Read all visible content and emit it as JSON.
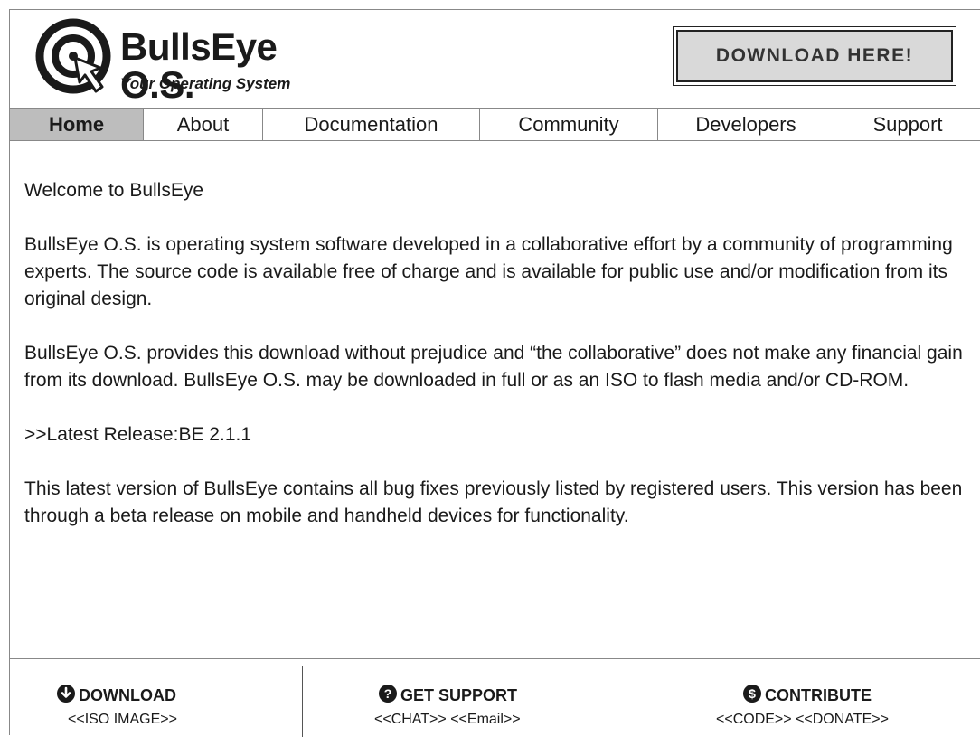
{
  "header": {
    "brand_name": "BullsEye O.S.",
    "tagline": "Your Operating System",
    "download_label": "DOWNLOAD HERE!"
  },
  "nav": {
    "items": [
      {
        "label": "Home",
        "active": true
      },
      {
        "label": "About"
      },
      {
        "label": "Documentation"
      },
      {
        "label": "Community"
      },
      {
        "label": "Developers"
      },
      {
        "label": "Support"
      }
    ]
  },
  "main": {
    "welcome": "Welcome to BullsEye",
    "para1": "BullsEye O.S. is operating system software developed in a collaborative effort by a community of programming experts. The source code is available free of charge and is available for public use and/or modification from its original design.",
    "para2": "BullsEye O.S. provides this download without prejudice and “the collaborative” does not make any financial gain from its download. BullsEye O.S. may be downloaded in full or as an ISO to flash media and/or CD-ROM.",
    "latest_release": ">>Latest Release:BE 2.1.1",
    "para3": "This latest version of BullsEye contains all bug fixes previously listed by registered users. This version has been through a beta release on mobile and handheld devices for functionality."
  },
  "footer": {
    "download": {
      "title": "DOWNLOAD",
      "icon": "download-circle-icon",
      "link1": "<<ISO IMAGE>>"
    },
    "support": {
      "title": "GET SUPPORT",
      "icon": "question-circle-icon",
      "link1": "<<CHAT>>",
      "link2": "<<Email>>"
    },
    "contribute": {
      "title": "CONTRIBUTE",
      "icon": "dollar-circle-icon",
      "link1": "<<CODE>>",
      "link2": "<<DONATE>>"
    }
  },
  "colors": {
    "nav_active_bg": "#bdbdbd",
    "button_bg": "#d9d9d9",
    "text": "#1a1a1a"
  }
}
